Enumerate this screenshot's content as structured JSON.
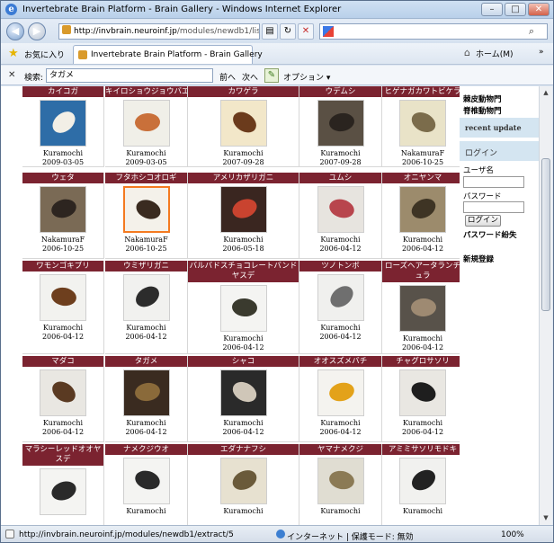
{
  "window": {
    "title": "Invertebrate Brain Platform - Brain Gallery - Windows Internet Explorer"
  },
  "address_bar": {
    "url_host": "http://invbrain.neuroinf.jp",
    "url_rest": "/modules/newdb1/list.php"
  },
  "favorites_bar": {
    "favorites_label": "お気に入り",
    "tab_title": "Invertebrate Brain Platform - Brain Gallery",
    "home_label": "ホーム(M)"
  },
  "find_bar": {
    "label": "検索:",
    "query": "タガメ",
    "prev_label": "前へ",
    "next_label": "次へ",
    "options_label": "オプション ▾"
  },
  "gallery": [
    {
      "name": "カイコガ",
      "author": "Kuramochi",
      "date": "2009-03-05"
    },
    {
      "name": "キイロショウジョウバエ",
      "author": "Kuramochi",
      "date": "2009-03-05"
    },
    {
      "name": "カワゲラ",
      "author": "Kuramochi",
      "date": "2007-09-28"
    },
    {
      "name": "ウデムシ",
      "author": "Kuramochi",
      "date": "2007-09-28"
    },
    {
      "name": "ヒゲナガカワトビケラ",
      "author": "NakamuraF",
      "date": "2006-10-25"
    },
    {
      "name": "ウェタ",
      "author": "NakamuraF",
      "date": "2006-10-25"
    },
    {
      "name": "フタホシコオロギ",
      "author": "NakamuraF",
      "date": "2006-10-25"
    },
    {
      "name": "アメリカザリガニ",
      "author": "Kuramochi",
      "date": "2006-05-18"
    },
    {
      "name": "ユムシ",
      "author": "Kuramochi",
      "date": "2006-04-12"
    },
    {
      "name": "オニヤンマ",
      "author": "Kuramochi",
      "date": "2006-04-12"
    },
    {
      "name": "ワモンゴキブリ",
      "author": "Kuramochi",
      "date": "2006-04-12"
    },
    {
      "name": "ウミザリガニ",
      "author": "Kuramochi",
      "date": "2006-04-12"
    },
    {
      "name": "バルバドスチョコレートバンドヤスデ",
      "author": "Kuramochi",
      "date": "2006-04-12"
    },
    {
      "name": "ツノトンボ",
      "author": "Kuramochi",
      "date": "2006-04-12"
    },
    {
      "name": "ローズヘアータランチュラ",
      "author": "Kuramochi",
      "date": "2006-04-12"
    },
    {
      "name": "マダコ",
      "author": "Kuramochi",
      "date": "2006-04-12"
    },
    {
      "name": "タガメ",
      "author": "Kuramochi",
      "date": "2006-04-12"
    },
    {
      "name": "シャコ",
      "author": "Kuramochi",
      "date": "2006-04-12"
    },
    {
      "name": "オオスズメバチ",
      "author": "Kuramochi",
      "date": "2006-04-12"
    },
    {
      "name": "チャグロサソリ",
      "author": "Kuramochi",
      "date": "2006-04-12"
    },
    {
      "name": "マラシーレッドオオヤスデ",
      "author": "",
      "date": ""
    },
    {
      "name": "ナメクジウオ",
      "author": "Kuramochi",
      "date": ""
    },
    {
      "name": "エダナナフシ",
      "author": "Kuramochi",
      "date": ""
    },
    {
      "name": "ヤマナメクジ",
      "author": "Kuramochi",
      "date": ""
    },
    {
      "name": "アミミサソリモドキ",
      "author": "Kuramochi",
      "date": ""
    }
  ],
  "sidebar": {
    "link1": "棘皮動物門",
    "link2": "脊椎動物門",
    "recent_update": "recent update",
    "login_header": "ログイン",
    "user_label": "ユーザ名",
    "password_label": "パスワード",
    "login_button": "ログイン",
    "lost_password": "パスワード紛失",
    "register": "新規登録"
  },
  "status_bar": {
    "status_text": "http://invbrain.neuroinf.jp/modules/newdb1/extract/5",
    "zone_text": "インターネット | 保護モード: 無効",
    "zoom": "100%"
  }
}
